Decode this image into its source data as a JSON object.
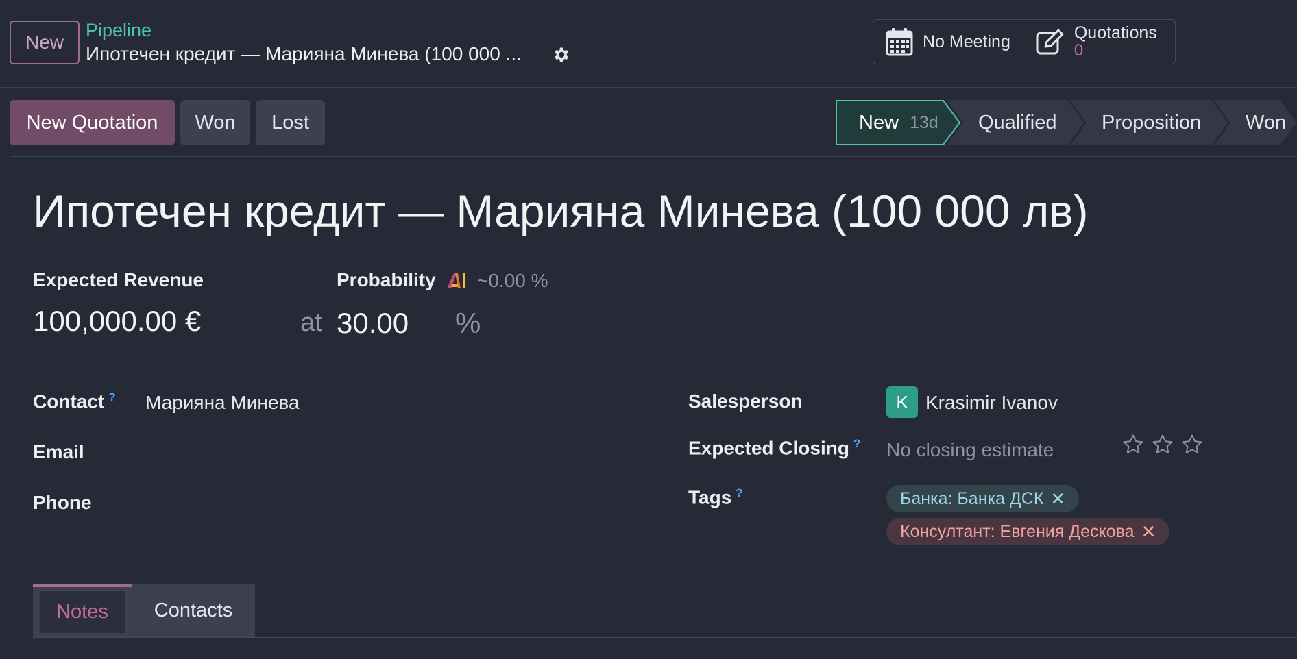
{
  "header": {
    "new_button": "New",
    "breadcrumb": "Pipeline",
    "record_title": "Ипотечен кредит — Марияна Минева (100 000 ...",
    "settings_icon": "gear-icon"
  },
  "smart_buttons": {
    "meeting": {
      "label": "No Meeting",
      "icon": "calendar-icon"
    },
    "quotations": {
      "label": "Quotations",
      "count": "0",
      "icon": "edit-icon"
    }
  },
  "actions": {
    "new_quotation": "New Quotation",
    "won": "Won",
    "lost": "Lost"
  },
  "stages": [
    {
      "label": "New",
      "days": "13d",
      "active": true
    },
    {
      "label": "Qualified"
    },
    {
      "label": "Proposition"
    },
    {
      "label": "Won"
    }
  ],
  "form": {
    "title": "Ипотечен кредит — Марияна Минева (100 000 лв)",
    "expected_revenue_label": "Expected Revenue",
    "expected_revenue": "100,000.00 €",
    "at": "at",
    "probability_label": "Probability",
    "ai_probability": "~0.00 %",
    "probability": "30.00",
    "percent": "%",
    "contact_label": "Contact",
    "contact_help": "?",
    "contact": "Марияна Минева",
    "email_label": "Email",
    "phone_label": "Phone",
    "salesperson_label": "Salesperson",
    "salesperson_initial": "K",
    "salesperson": "Krasimir Ivanov",
    "closing_label": "Expected Closing",
    "closing_help": "?",
    "closing_placeholder": "No closing estimate",
    "priority_stars": 0,
    "tags_label": "Tags",
    "tags_help": "?",
    "tags": [
      {
        "label": "Банка: Банка ДСК",
        "remove": "✕"
      },
      {
        "label": "Консултант: Евгения Дескова",
        "remove": "✕"
      }
    ]
  },
  "tabs": [
    {
      "label": "Notes",
      "active": true
    },
    {
      "label": "Contacts"
    }
  ],
  "colors": {
    "background": "#262a36",
    "primary": "#714b67",
    "accent_teal": "#4fc1ab",
    "active_stage": "#1f3b3a"
  }
}
